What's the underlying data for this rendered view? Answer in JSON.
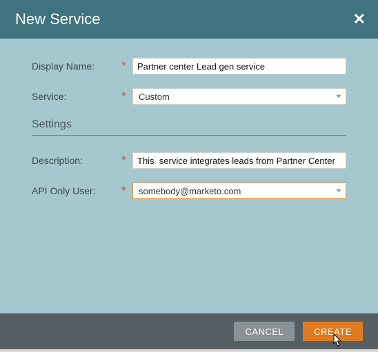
{
  "dialog": {
    "title": "New Service",
    "close_label": "✕"
  },
  "form": {
    "display_name": {
      "label": "Display Name:",
      "value": "Partner center Lead gen service",
      "required": "*"
    },
    "service": {
      "label": "Service:",
      "value": "Custom",
      "required": "*"
    },
    "settings_heading": "Settings",
    "description": {
      "label": "Description:",
      "value": "This  service integrates leads from Partner Center",
      "required": "*"
    },
    "api_only_user": {
      "label": "API Only User:",
      "value": "somebody@marketo.com",
      "required": "*"
    }
  },
  "footer": {
    "cancel": "CANCEL",
    "create": "CREATE"
  }
}
